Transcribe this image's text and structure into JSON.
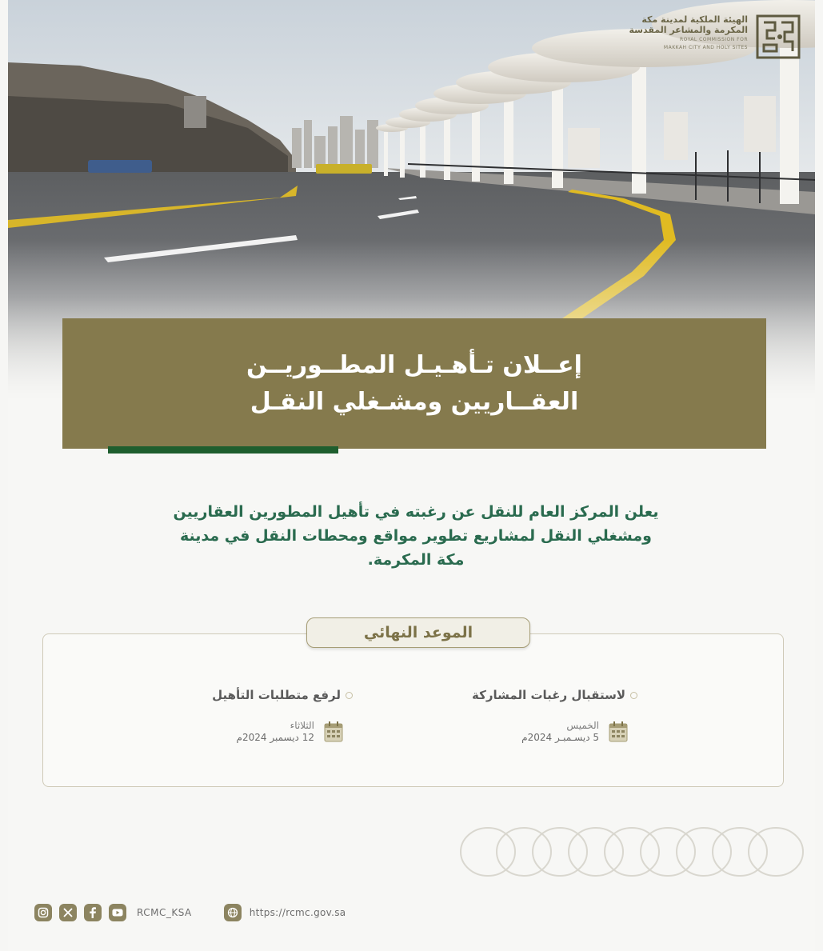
{
  "logo": {
    "ar_line1": "الهيئة الملكية لمدينة مكة",
    "ar_line2": "المكرمة والمشاعر المقدسة",
    "en_line1": "ROYAL COMMISSION FOR",
    "en_line2": "MAKKAH CITY AND HOLY SITES"
  },
  "title": {
    "line1": "إعــلان تـأهـيـل المطــوريــن",
    "line2": "العقــاريين ومشـغلي النقـل"
  },
  "intro": {
    "line1": "يعلن المركز العام للنقل عن رغبته في تأهيل المطورين العقاريين",
    "line2": "ومشغلي النقل لمشاريع تطوير مواقع ومحطات النقل في مدينة",
    "line3": "مكة المكرمة."
  },
  "deadline": {
    "label": "الموعد النهائي",
    "items": [
      {
        "heading": "لاستقبال رغبات المشاركة",
        "day": "الخميس",
        "date": "5 ديسـمبـر 2024م"
      },
      {
        "heading": "لرفع متطلبات التأهيل",
        "day": "الثلاثاء",
        "date": "12 ديسمبر 2024م"
      }
    ]
  },
  "footer": {
    "social_icons": [
      "instagram-icon",
      "x-icon",
      "facebook-icon",
      "youtube-icon"
    ],
    "handle": "RCMC_KSA",
    "url": "https://rcmc.gov.sa"
  },
  "colors": {
    "title_box": "#857a4d",
    "accent_green": "#1e5e2e",
    "intro_text": "#2a6b4f",
    "icon_bg": "#8c8460"
  }
}
